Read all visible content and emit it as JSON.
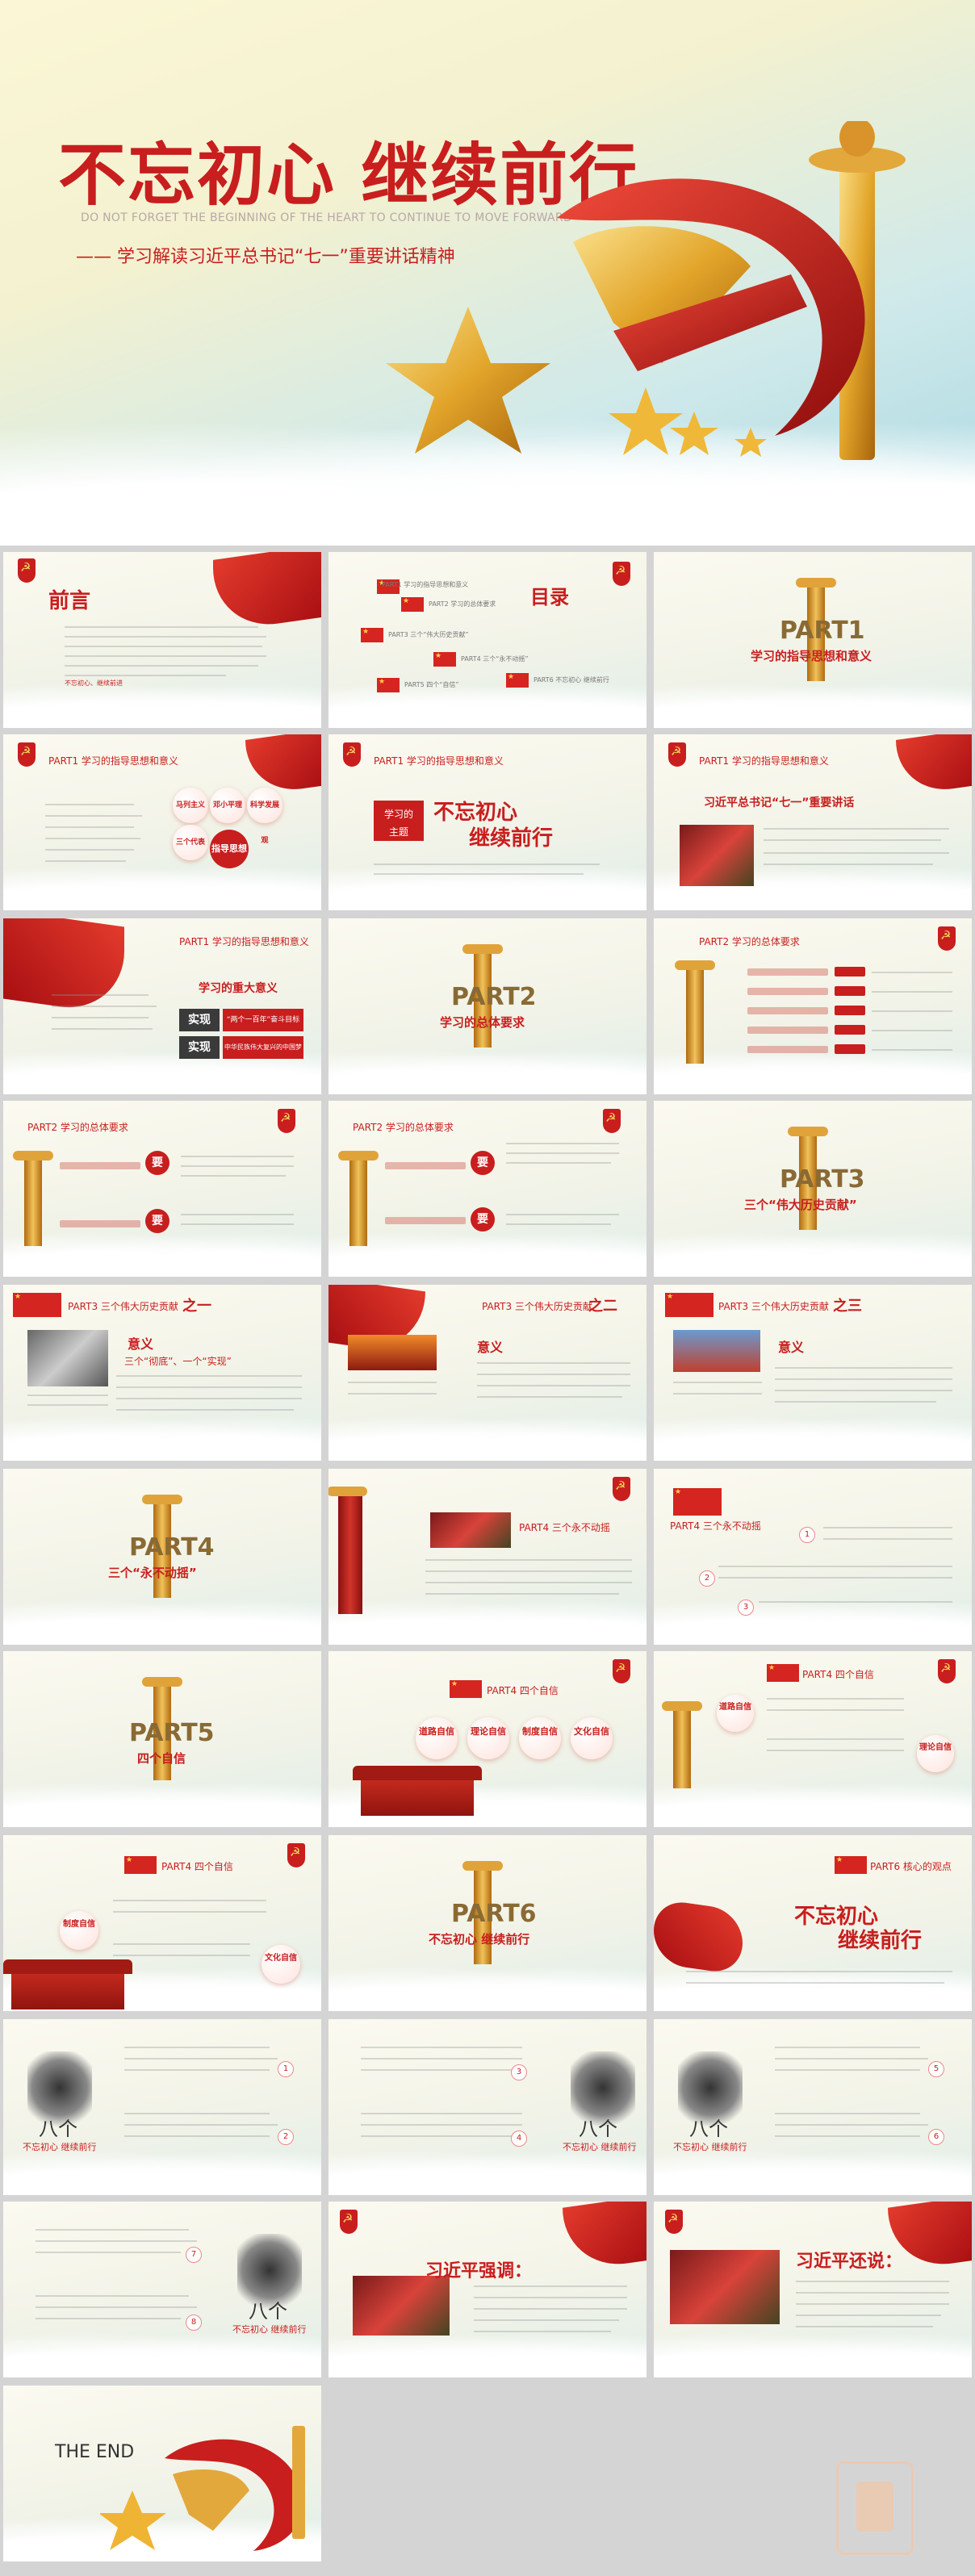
{
  "hero": {
    "title": "不忘初心 继续前行",
    "subtitle_en": "DO NOT FORGET THE BEGINNING OF THE HEART TO CONTINUE TO MOVE FORWARD",
    "subtitle_cn": "—— 学习解读习近平总书记“七一”重要讲话精神"
  },
  "slides": {
    "s1": {
      "title": "前言",
      "highlight": "不忘初心、继续前进"
    },
    "s2": {
      "title": "目录",
      "items": [
        "PART1 学习的指导思想和意义",
        "PART2 学习的总体要求",
        "PART3 三个“伟大历史贡献”",
        "PART4 三个“永不动摇”",
        "PART5 四个“自信”",
        "PART6 不忘初心 继续前行"
      ]
    },
    "s3": {
      "part": "PART1",
      "sub": "学习的指导思想和意义"
    },
    "s4": {
      "head": "PART1 学习的指导思想和意义",
      "circle1": "马列主义",
      "circle2": "邓小平理论",
      "circle3": "科学发展观",
      "circle4": "三个代表",
      "center": "指导思想"
    },
    "s5": {
      "head": "PART1 学习的指导思想和意义",
      "box1": "学习的",
      "box2": "主题",
      "title1": "不忘初心",
      "title2": "继续前行"
    },
    "s6": {
      "head": "PART1 学习的指导思想和意义",
      "title": "习近平总书记“七一”重要讲话"
    },
    "s7": {
      "head": "PART1 学习的指导思想和意义",
      "title": "学习的重大意义",
      "b1": "实现",
      "t1": "“两个一百年”奋斗目标",
      "b2": "实现",
      "t2": "中华民族伟大复兴的中国梦"
    },
    "s8": {
      "part": "PART2",
      "sub": "学习的总体要求"
    },
    "s9": {
      "head": "PART2 学习的总体要求"
    },
    "s10": {
      "head": "PART2 学习的总体要求",
      "tag1": "要",
      "tag2": "要"
    },
    "s11": {
      "head": "PART2 学习的总体要求",
      "tag1": "要",
      "tag2": "要"
    },
    "s12": {
      "part": "PART3",
      "sub": "三个“伟大历史贡献”"
    },
    "s13": {
      "head": "PART3 三个伟大历史贡献",
      "num": "之一",
      "title": "意义",
      "line": "三个“彻底”、一个“实现”"
    },
    "s14": {
      "head": "PART3 三个伟大历史贡献",
      "num": "之二",
      "title": "意义"
    },
    "s15": {
      "head": "PART3 三个伟大历史贡献",
      "num": "之三",
      "title": "意义"
    },
    "s16": {
      "part": "PART4",
      "sub": "三个“永不动摇”"
    },
    "s17": {
      "head": "PART4 三个永不动摇"
    },
    "s18": {
      "head": "PART4 三个永不动摇",
      "n1": "1",
      "n2": "2",
      "n3": "3"
    },
    "s19": {
      "part": "PART5",
      "sub": "四个自信"
    },
    "s20": {
      "head": "PART4 四个自信",
      "c1": "道路自信",
      "c2": "理论自信",
      "c3": "制度自信",
      "c4": "文化自信"
    },
    "s21": {
      "head": "PART4 四个自信",
      "c1": "道路自信",
      "c2": "理论自信"
    },
    "s22": {
      "head": "PART4 四个自信",
      "c1": "制度自信",
      "c2": "文化自信"
    },
    "s23": {
      "part": "PART6",
      "sub": "不忘初心 继续前行"
    },
    "s24": {
      "head": "PART6 核心的观点",
      "title1": "不忘初心",
      "title2": "继续前行"
    },
    "s25": {
      "label": "八个",
      "sub": "不忘初心 继续前行",
      "n1": "1",
      "n2": "2"
    },
    "s26": {
      "label": "八个",
      "sub": "不忘初心 继续前行",
      "n1": "3",
      "n2": "4"
    },
    "s27": {
      "label": "八个",
      "sub": "不忘初心 继续前行",
      "n1": "5",
      "n2": "6"
    },
    "s28": {
      "label": "八个",
      "sub": "不忘初心 继续前行",
      "n1": "7",
      "n2": "8"
    },
    "s29": {
      "title": "习近平强调："
    },
    "s30": {
      "title": "习近平还说："
    },
    "s31": {
      "title": "THE END"
    }
  },
  "colors": {
    "accent": "#c81e1e",
    "gold": "#e0a33a"
  }
}
